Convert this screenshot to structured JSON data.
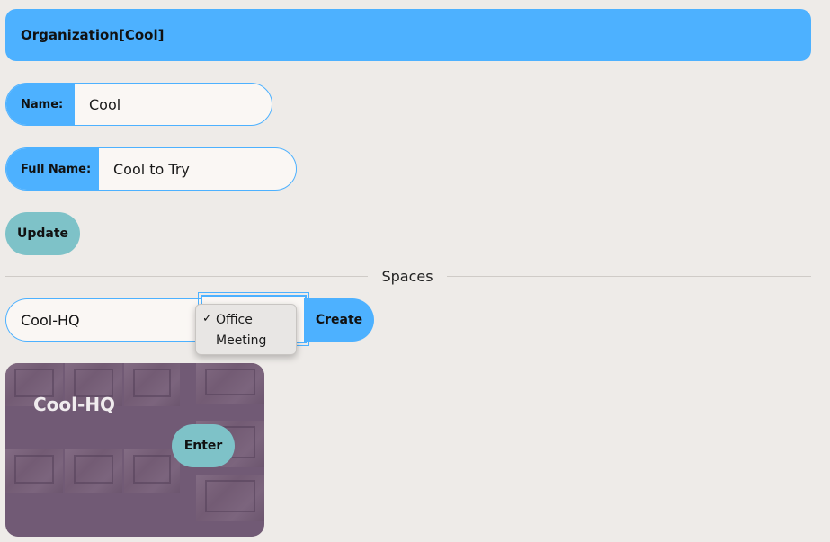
{
  "header": {
    "title": "Organization[Cool]"
  },
  "form": {
    "name_label": "Name:",
    "name_value": "Cool",
    "fullname_label": "Full Name:",
    "fullname_value": "Cool to Try",
    "update_label": "Update"
  },
  "spaces": {
    "divider_label": "Spaces",
    "new_space_value": "Cool-HQ",
    "type_options": [
      "Office",
      "Meeting"
    ],
    "selected_type": "Office",
    "check_mark": "✓",
    "create_label": "Create"
  },
  "cards": [
    {
      "title": "Cool-HQ",
      "enter_label": "Enter"
    }
  ],
  "colors": {
    "accent": "#4db1ff",
    "secondary": "#7ec2c8",
    "background": "#eeebe8",
    "card_overlay": "#62486e"
  }
}
